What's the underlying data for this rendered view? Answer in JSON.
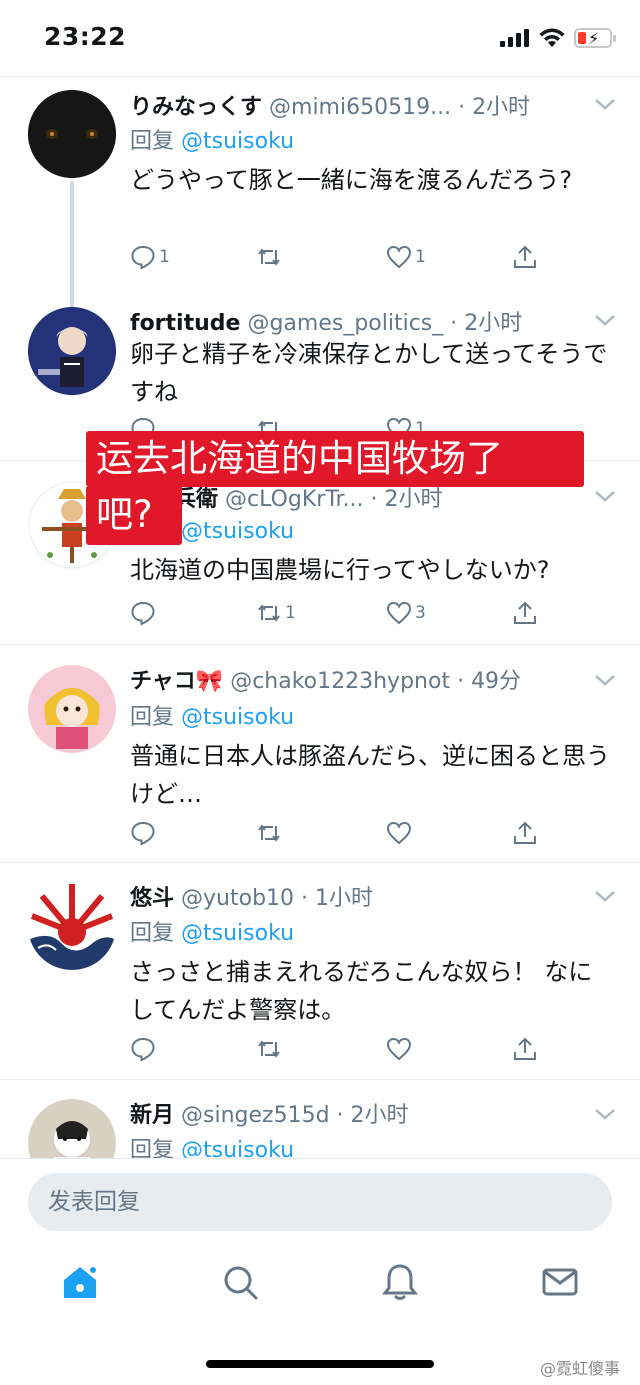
{
  "status": {
    "time": "23:22"
  },
  "replies": [
    {
      "name": "りみなっくす",
      "handle": "@mimi650519...",
      "time": "· 2小时",
      "replying_prefix": "回复",
      "replying_to": "@tsuisoku",
      "text": "どうやって豚と一緒に海を渡るんだろう?",
      "reply_count": "1",
      "retweet_count": "",
      "like_count": "1"
    },
    {
      "name": "fortitude",
      "handle": "@games_politics_",
      "time": "· 2小时",
      "text": "卵子と精子を冷凍保存とかして送ってそうですね",
      "reply_count": "",
      "retweet_count": "",
      "like_count": "1"
    },
    {
      "name": "の団兵衛",
      "handle": "@cLOgKrTr...",
      "time": "· 2小时",
      "replying_prefix": "回复",
      "replying_to": "@tsuisoku",
      "text": "北海道の中国農場に行ってやしないか?",
      "reply_count": "",
      "retweet_count": "1",
      "like_count": "3"
    },
    {
      "name": "チャコ🎀",
      "handle": "@chako1223hypnot",
      "time": "· 49分",
      "replying_prefix": "回复",
      "replying_to": "@tsuisoku",
      "text": "普通に日本人は豚盗んだら、逆に困ると思うけど…",
      "reply_count": "",
      "retweet_count": "",
      "like_count": ""
    },
    {
      "name": "悠斗",
      "handle": "@yutob10",
      "time": "· 1小时",
      "replying_prefix": "回复",
      "replying_to": "@tsuisoku",
      "text": "さっさと捕まえれるだろこんな奴ら！ なにしてんだよ警察は。",
      "reply_count": "",
      "retweet_count": "",
      "like_count": ""
    },
    {
      "name": "新月",
      "handle": "@singez515d",
      "time": "· 2小时",
      "replying_prefix": "回复",
      "replying_to": "@tsuisoku",
      "text": "",
      "reply_count": "",
      "retweet_count": "",
      "like_count": ""
    }
  ],
  "overlay": {
    "line1": "运去北海道的中国牧场了",
    "line2": "吧?"
  },
  "compose": {
    "placeholder": "发表回复"
  },
  "watermark": "@霓虹傻事",
  "colors": {
    "accent": "#1da1f2",
    "secondary_text": "#657786",
    "overlay_red": "#e0182a"
  }
}
